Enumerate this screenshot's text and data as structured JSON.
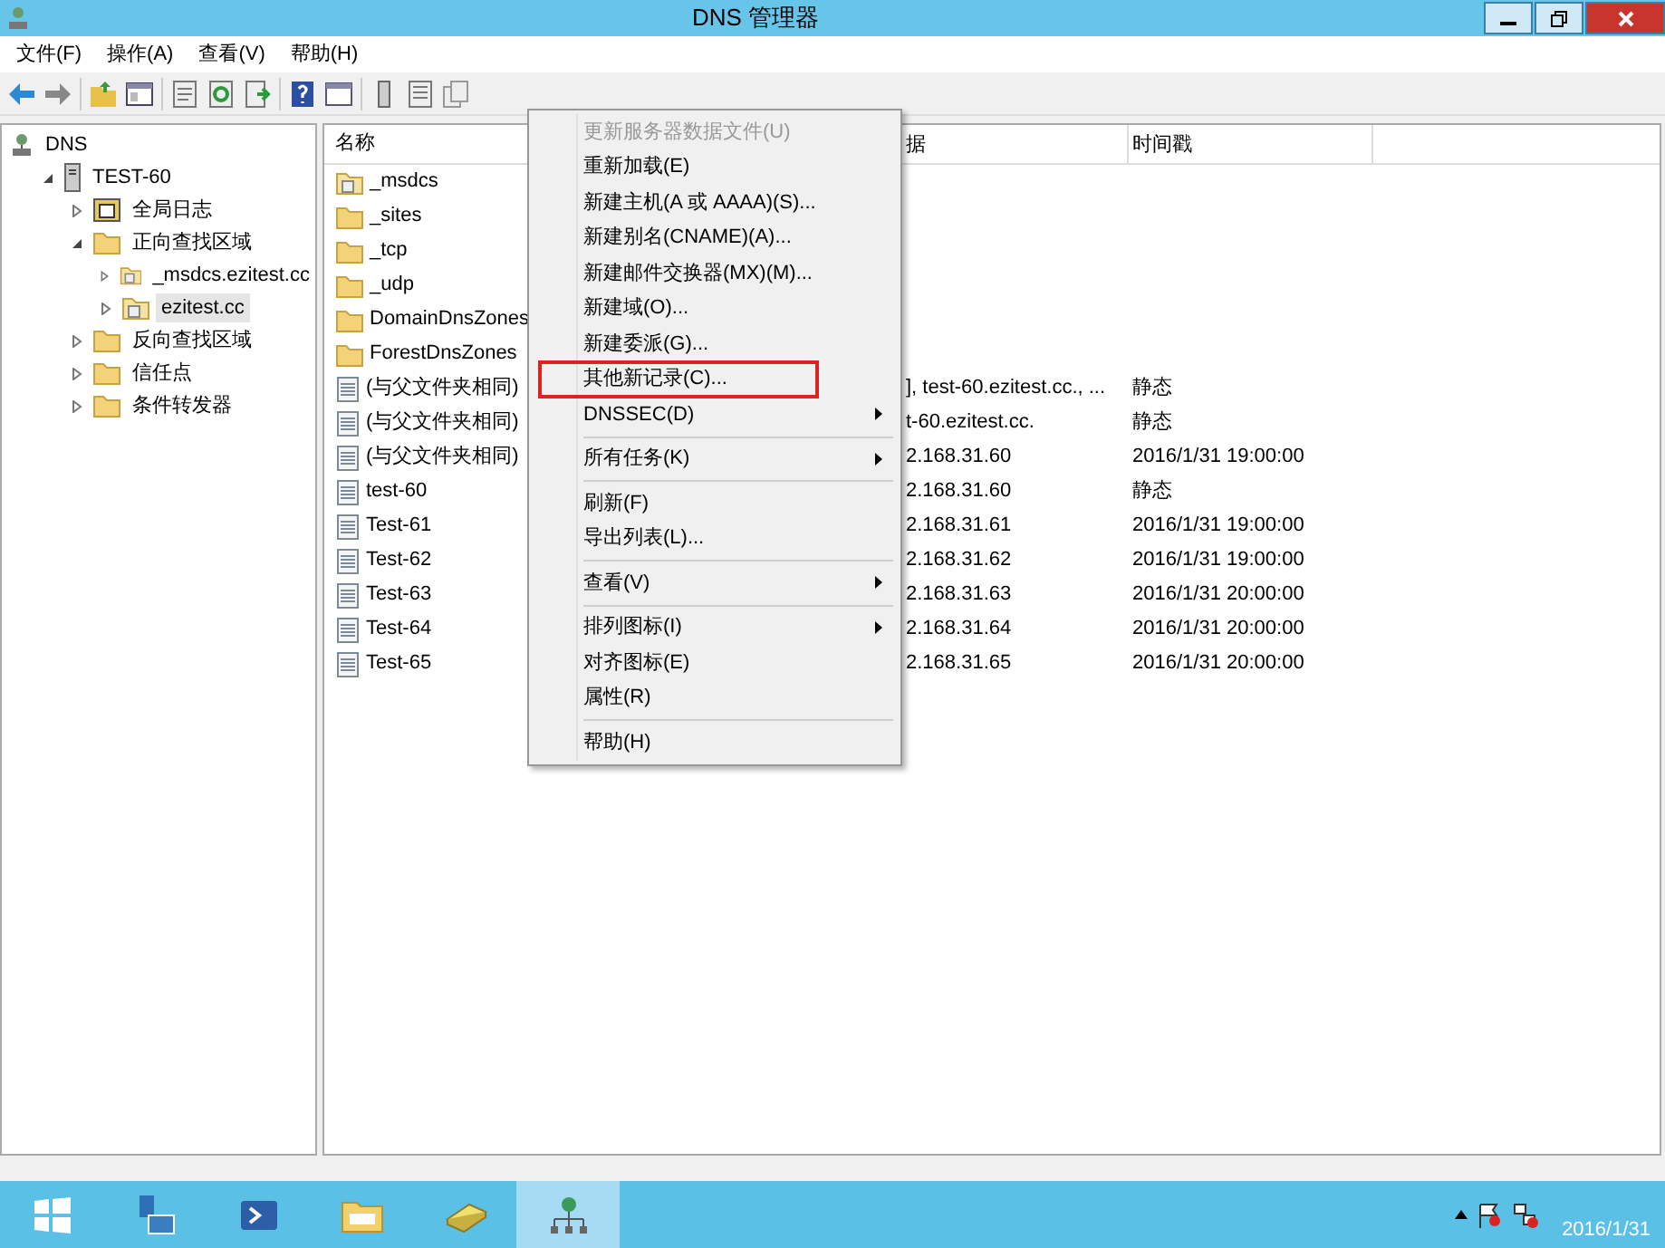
{
  "window": {
    "title": "DNS 管理器"
  },
  "menu_bar": [
    "文件(F)",
    "操作(A)",
    "查看(V)",
    "帮助(H)"
  ],
  "tree": {
    "label": "DNS",
    "kind": "root",
    "selected": false,
    "children": [
      {
        "label": "TEST-60",
        "kind": "server",
        "expanded": true,
        "selected": false,
        "children": [
          {
            "label": "全局日志",
            "kind": "log",
            "expanded": false,
            "selected": false
          },
          {
            "label": "正向查找区域",
            "kind": "folder",
            "expanded": true,
            "selected": false,
            "children": [
              {
                "label": "_msdcs.ezitest.cc",
                "kind": "zone",
                "expanded": false,
                "selected": false
              },
              {
                "label": "ezitest.cc",
                "kind": "zone",
                "expanded": false,
                "selected": true
              }
            ]
          },
          {
            "label": "反向查找区域",
            "kind": "folder",
            "expanded": false,
            "selected": false
          },
          {
            "label": "信任点",
            "kind": "folder",
            "expanded": false,
            "selected": false
          },
          {
            "label": "条件转发器",
            "kind": "folder",
            "expanded": false,
            "selected": false
          }
        ]
      }
    ]
  },
  "list": {
    "columns": [
      "名称",
      "据",
      "时间戳"
    ],
    "rows": [
      {
        "kind": "zone",
        "name": "_msdcs",
        "data": "",
        "timestamp": ""
      },
      {
        "kind": "folder",
        "name": "_sites",
        "data": "",
        "timestamp": ""
      },
      {
        "kind": "folder",
        "name": "_tcp",
        "data": "",
        "timestamp": ""
      },
      {
        "kind": "folder",
        "name": "_udp",
        "data": "",
        "timestamp": ""
      },
      {
        "kind": "folder",
        "name": "DomainDnsZones",
        "data": "",
        "timestamp": ""
      },
      {
        "kind": "folder",
        "name": "ForestDnsZones",
        "data": "",
        "timestamp": ""
      },
      {
        "kind": "record",
        "name": "(与父文件夹相同)",
        "data": "], test-60.ezitest.cc., ...",
        "timestamp": "静态"
      },
      {
        "kind": "record",
        "name": "(与父文件夹相同)",
        "data": "t-60.ezitest.cc.",
        "timestamp": "静态"
      },
      {
        "kind": "record",
        "name": "(与父文件夹相同)",
        "data": "2.168.31.60",
        "timestamp": "2016/1/31 19:00:00"
      },
      {
        "kind": "record",
        "name": "test-60",
        "data": "2.168.31.60",
        "timestamp": "静态"
      },
      {
        "kind": "record",
        "name": "Test-61",
        "data": "2.168.31.61",
        "timestamp": "2016/1/31 19:00:00"
      },
      {
        "kind": "record",
        "name": "Test-62",
        "data": "2.168.31.62",
        "timestamp": "2016/1/31 19:00:00"
      },
      {
        "kind": "record",
        "name": "Test-63",
        "data": "2.168.31.63",
        "timestamp": "2016/1/31 20:00:00"
      },
      {
        "kind": "record",
        "name": "Test-64",
        "data": "2.168.31.64",
        "timestamp": "2016/1/31 20:00:00"
      },
      {
        "kind": "record",
        "name": "Test-65",
        "data": "2.168.31.65",
        "timestamp": "2016/1/31 20:00:00"
      }
    ]
  },
  "context_menu": {
    "groups": [
      [
        {
          "label": "更新服务器数据文件(U)",
          "disabled": true,
          "submenu": false,
          "highlighted": false
        },
        {
          "label": "重新加载(E)",
          "disabled": false,
          "submenu": false,
          "highlighted": false
        },
        {
          "label": "新建主机(A 或 AAAA)(S)...",
          "disabled": false,
          "submenu": false,
          "highlighted": false
        },
        {
          "label": "新建别名(CNAME)(A)...",
          "disabled": false,
          "submenu": false,
          "highlighted": false
        },
        {
          "label": "新建邮件交换器(MX)(M)...",
          "disabled": false,
          "submenu": false,
          "highlighted": false
        },
        {
          "label": "新建域(O)...",
          "disabled": false,
          "submenu": false,
          "highlighted": false
        },
        {
          "label": "新建委派(G)...",
          "disabled": false,
          "submenu": false,
          "highlighted": false
        },
        {
          "label": "其他新记录(C)...",
          "disabled": false,
          "submenu": false,
          "highlighted": true
        },
        {
          "label": "DNSSEC(D)",
          "disabled": false,
          "submenu": true,
          "highlighted": false
        }
      ],
      [
        {
          "label": "所有任务(K)",
          "disabled": false,
          "submenu": true,
          "highlighted": false
        }
      ],
      [
        {
          "label": "刷新(F)",
          "disabled": false,
          "submenu": false,
          "highlighted": false
        },
        {
          "label": "导出列表(L)...",
          "disabled": false,
          "submenu": false,
          "highlighted": false
        }
      ],
      [
        {
          "label": "查看(V)",
          "disabled": false,
          "submenu": true,
          "highlighted": false
        }
      ],
      [
        {
          "label": "排列图标(I)",
          "disabled": false,
          "submenu": true,
          "highlighted": false
        },
        {
          "label": "对齐图标(E)",
          "disabled": false,
          "submenu": false,
          "highlighted": false
        },
        {
          "label": "属性(R)",
          "disabled": false,
          "submenu": false,
          "highlighted": false
        }
      ],
      [
        {
          "label": "帮助(H)",
          "disabled": false,
          "submenu": false,
          "highlighted": false
        }
      ]
    ]
  },
  "taskbar": {
    "clock": "2016/1/31"
  }
}
